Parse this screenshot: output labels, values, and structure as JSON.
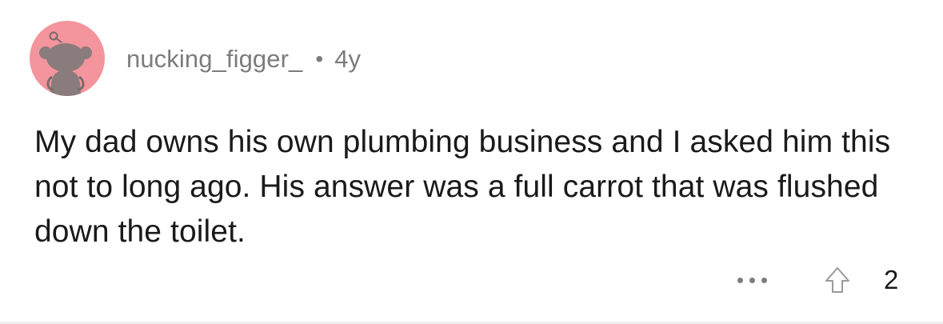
{
  "comment": {
    "author": "nucking_figger_",
    "separator": "•",
    "age": "4y",
    "body": "My dad owns his own plumbing business and I asked him this not to long ago. His answer was a full carrot that was flushed down the toilet.",
    "score": "2"
  },
  "icons": {
    "avatar": "reddit-snoo-avatar-icon",
    "more": "more-options-icon",
    "upvote": "upvote-arrow-icon"
  },
  "colors": {
    "avatar_bg": "#f4949c",
    "meta_text": "#7c7c7c",
    "body_text": "#1a1a1b"
  }
}
